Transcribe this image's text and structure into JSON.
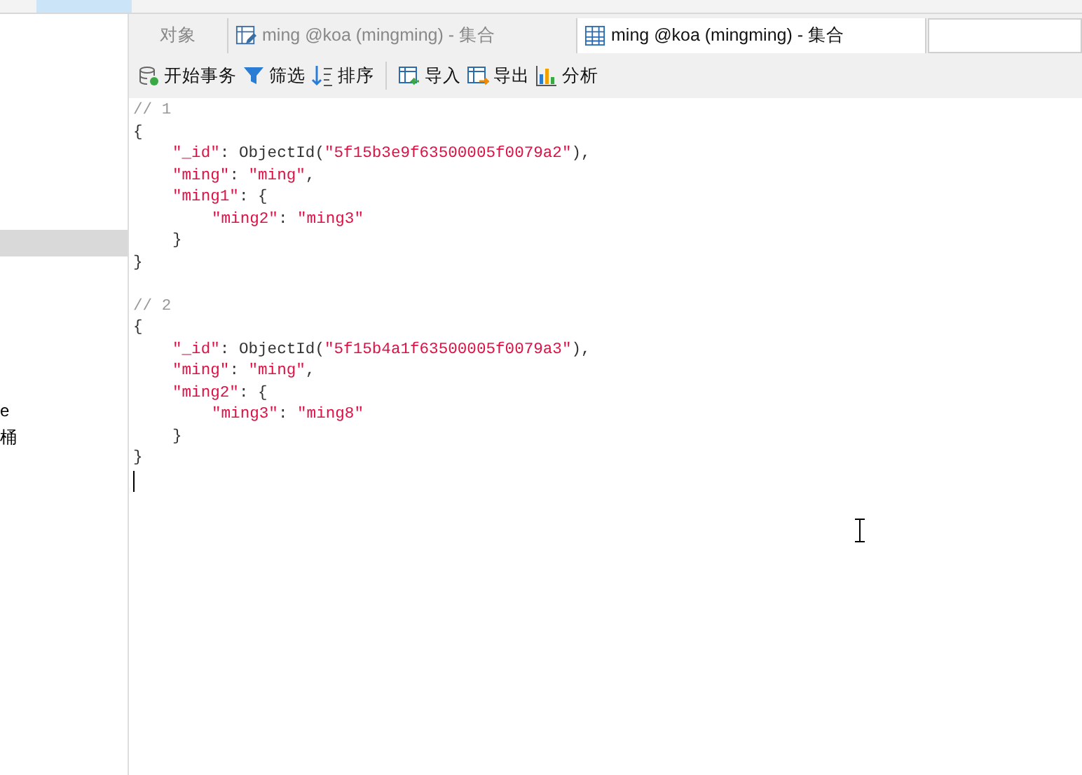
{
  "menu_tabs": [
    {
      "selected": true
    },
    {
      "selected": false
    },
    {
      "selected": false
    },
    {
      "selected": false
    },
    {
      "selected": false
    },
    {
      "selected": false
    },
    {
      "selected": false
    },
    {
      "selected": false
    },
    {
      "selected": false
    },
    {
      "selected": false
    }
  ],
  "sidebar": {
    "items": [
      {
        "selected": true
      },
      {
        "label": "e",
        "selected": false
      },
      {
        "label": "桶",
        "selected": false
      }
    ]
  },
  "tabs": [
    {
      "label": "对象",
      "selected": false,
      "kind": "plain"
    },
    {
      "label": "ming @koa (mingming) - 集合",
      "selected": false,
      "kind": "edit"
    },
    {
      "label": "ming @koa (mingming) - 集合",
      "selected": true,
      "kind": "table"
    }
  ],
  "toolbar": [
    {
      "label": "开始事务",
      "kind": "transaction"
    },
    {
      "label": "筛选",
      "kind": "filter"
    },
    {
      "label": "排序",
      "kind": "sort"
    },
    {
      "kind": "separator"
    },
    {
      "label": "导入",
      "kind": "import"
    },
    {
      "label": "导出",
      "kind": "export"
    },
    {
      "label": "分析",
      "kind": "analyze"
    }
  ],
  "documents": [
    {
      "comment": "// 1",
      "open": "{",
      "close": "}",
      "children": [
        {
          "tokens": [
            {
              "kind": "string",
              "text": "\"_id\""
            },
            {
              "kind": "punct",
              "text": ": ObjectId("
            },
            {
              "kind": "string",
              "text": "\"5f15b3e9f63500005f0079a2\""
            },
            {
              "kind": "punct",
              "text": "),"
            }
          ]
        },
        {
          "tokens": [
            {
              "kind": "string",
              "text": "\"ming\""
            },
            {
              "kind": "punct",
              "text": ": "
            },
            {
              "kind": "string",
              "text": "\"ming\""
            },
            {
              "kind": "punct",
              "text": ","
            }
          ]
        },
        {
          "tokens": [
            {
              "kind": "string",
              "text": "\"ming1\""
            },
            {
              "kind": "punct",
              "text": ": {"
            }
          ],
          "close": "}",
          "children": [
            {
              "tokens": [
                {
                  "kind": "string",
                  "text": "\"ming2\""
                },
                {
                  "kind": "punct",
                  "text": ": "
                },
                {
                  "kind": "string",
                  "text": "\"ming3\""
                }
              ]
            }
          ]
        }
      ]
    },
    {
      "comment": "// 2",
      "open": "{",
      "close": "}",
      "children": [
        {
          "tokens": [
            {
              "kind": "string",
              "text": "\"_id\""
            },
            {
              "kind": "punct",
              "text": ": ObjectId("
            },
            {
              "kind": "string",
              "text": "\"5f15b4a1f63500005f0079a3\""
            },
            {
              "kind": "punct",
              "text": "),"
            }
          ]
        },
        {
          "tokens": [
            {
              "kind": "string",
              "text": "\"ming\""
            },
            {
              "kind": "punct",
              "text": ": "
            },
            {
              "kind": "string",
              "text": "\"ming\""
            },
            {
              "kind": "punct",
              "text": ","
            }
          ]
        },
        {
          "tokens": [
            {
              "kind": "string",
              "text": "\"ming2\""
            },
            {
              "kind": "punct",
              "text": ": {"
            }
          ],
          "close": "}",
          "children": [
            {
              "tokens": [
                {
                  "kind": "string",
                  "text": "\"ming3\""
                },
                {
                  "kind": "punct",
                  "text": ": "
                },
                {
                  "kind": "string",
                  "text": "\"ming8\""
                }
              ]
            }
          ]
        }
      ]
    }
  ]
}
